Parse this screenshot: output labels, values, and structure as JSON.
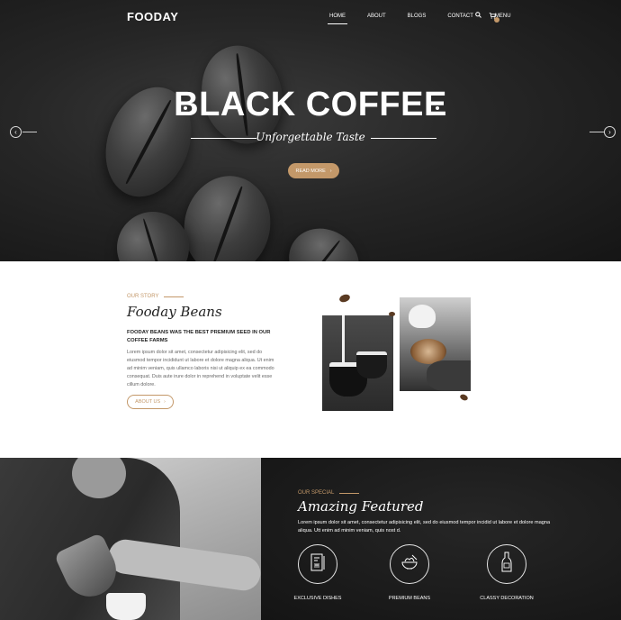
{
  "nav": {
    "logo": "FOODAY",
    "items": [
      "HOME",
      "ABOUT",
      "BLOGS",
      "CONTACT",
      "MENU"
    ],
    "search_icon": "search-icon",
    "cart_icon": "cart-icon"
  },
  "hero": {
    "title": "BLACK COFFEE",
    "subtitle": "Unforgettable Taste",
    "button": "READ MORE",
    "prev_icon": "chevron-left-icon",
    "next_icon": "chevron-right-icon"
  },
  "about": {
    "eyebrow": "OUR STORY",
    "title": "Fooday Beans",
    "subheading": "FOODAY BEANS WAS THE BEST PREMIUM SEED IN OUR COFFEE FARMS",
    "body": "Lorem ipsum dolor sit amet, consectetur adipisicing elit, sed do eiusmod tempor incididunt ut labore et dolore magna aliqua. Ut enim ad minim veniam, quis ullamco laboris nisi ut aliquip ex ea commodo consequat. Duis aute irure dolor in reprehend in voluptate velit esse cillum dolore.",
    "button": "ABOUT US"
  },
  "featured": {
    "eyebrow": "OUR SPECIAL",
    "title": "Amazing Featured",
    "body": "Lorem ipsum dolor sit amet, consectetur adipisicing elit, sed do eiusmod tempor incidid ut labore et dolore magna aliqua. Utt enim ad minim veniam, quis nost d.",
    "items": [
      {
        "label": "EXCLUSIVE DISHES",
        "icon": "menu-card-icon"
      },
      {
        "label": "PREMIUM BEANS",
        "icon": "bowl-icon"
      },
      {
        "label": "CLASSY DECORATION",
        "icon": "wine-bottle-icon"
      }
    ]
  },
  "colors": {
    "accent": "#c39869",
    "dark": "#1b1b1b"
  }
}
